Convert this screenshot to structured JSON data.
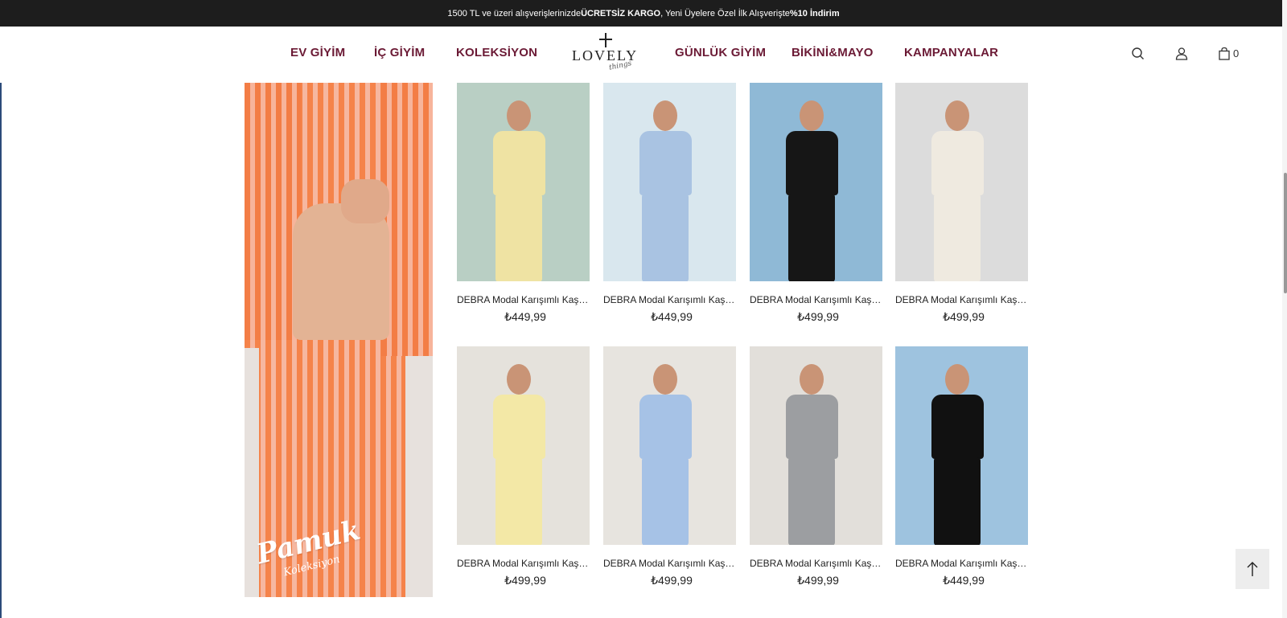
{
  "announcement": {
    "prefix": "1500 TL ve üzeri alışverişlerinizde ",
    "bold1": "ÜCRETSİZ KARGO",
    "middle": ", Yeni Üyelere Özel İlk Alışverişte ",
    "bold2": "%10 İndirim"
  },
  "nav": {
    "left": [
      "EV GİYİM",
      "İÇ GİYİM",
      "KOLEKSİYON"
    ],
    "right": [
      "GÜNLÜK GİYİM",
      "BİKİNİ&MAYO",
      "KAMPANYALAR"
    ]
  },
  "logo": {
    "word": "LOVELY",
    "script": "things"
  },
  "header_icons": [
    "search-icon",
    "user-icon",
    "shopping-bag-icon"
  ],
  "cart_count": "0",
  "banner": {
    "script_line1": "Pamuk",
    "script_line2": "Koleksiyon"
  },
  "products": [
    {
      "title": "DEBRA Modal Karışımlı Kaşkorse Pijama Takımı",
      "price": "₺449,99",
      "color": "#efe3a3",
      "bg": "#b9cfc4"
    },
    {
      "title": "DEBRA Modal Karışımlı Kaşkorse Pijama Takımı",
      "price": "₺449,99",
      "color": "#a9c3e2",
      "bg": "#d9e7ee"
    },
    {
      "title": "DEBRA Modal Karışımlı Kaşkorse Pijama Takımı",
      "price": "₺499,99",
      "color": "#161616",
      "bg": "#8fb9d6"
    },
    {
      "title": "DEBRA Modal Karışımlı Kaşkorse Pijama Takımı",
      "price": "₺499,99",
      "color": "#efeae0",
      "bg": "#dcdcdc"
    },
    {
      "title": "DEBRA Modal Karışımlı Kaşkorse Pijama Takımı",
      "price": "₺499,99",
      "color": "#f3e8a6",
      "bg": "#e5e2dc"
    },
    {
      "title": "DEBRA Modal Karışımlı Kaşkorse Pijama Takımı",
      "price": "₺499,99",
      "color": "#a6c2e6",
      "bg": "#e7e4df"
    },
    {
      "title": "DEBRA Modal Karışımlı Kaşkorse Pijama Takımı",
      "price": "₺499,99",
      "color": "#9c9ea1",
      "bg": "#e2dfda"
    },
    {
      "title": "DEBRA Modal Karışımlı Kaşkorse Pijama Takımı",
      "price": "₺449,99",
      "color": "#111111",
      "bg": "#9ec3df"
    }
  ]
}
